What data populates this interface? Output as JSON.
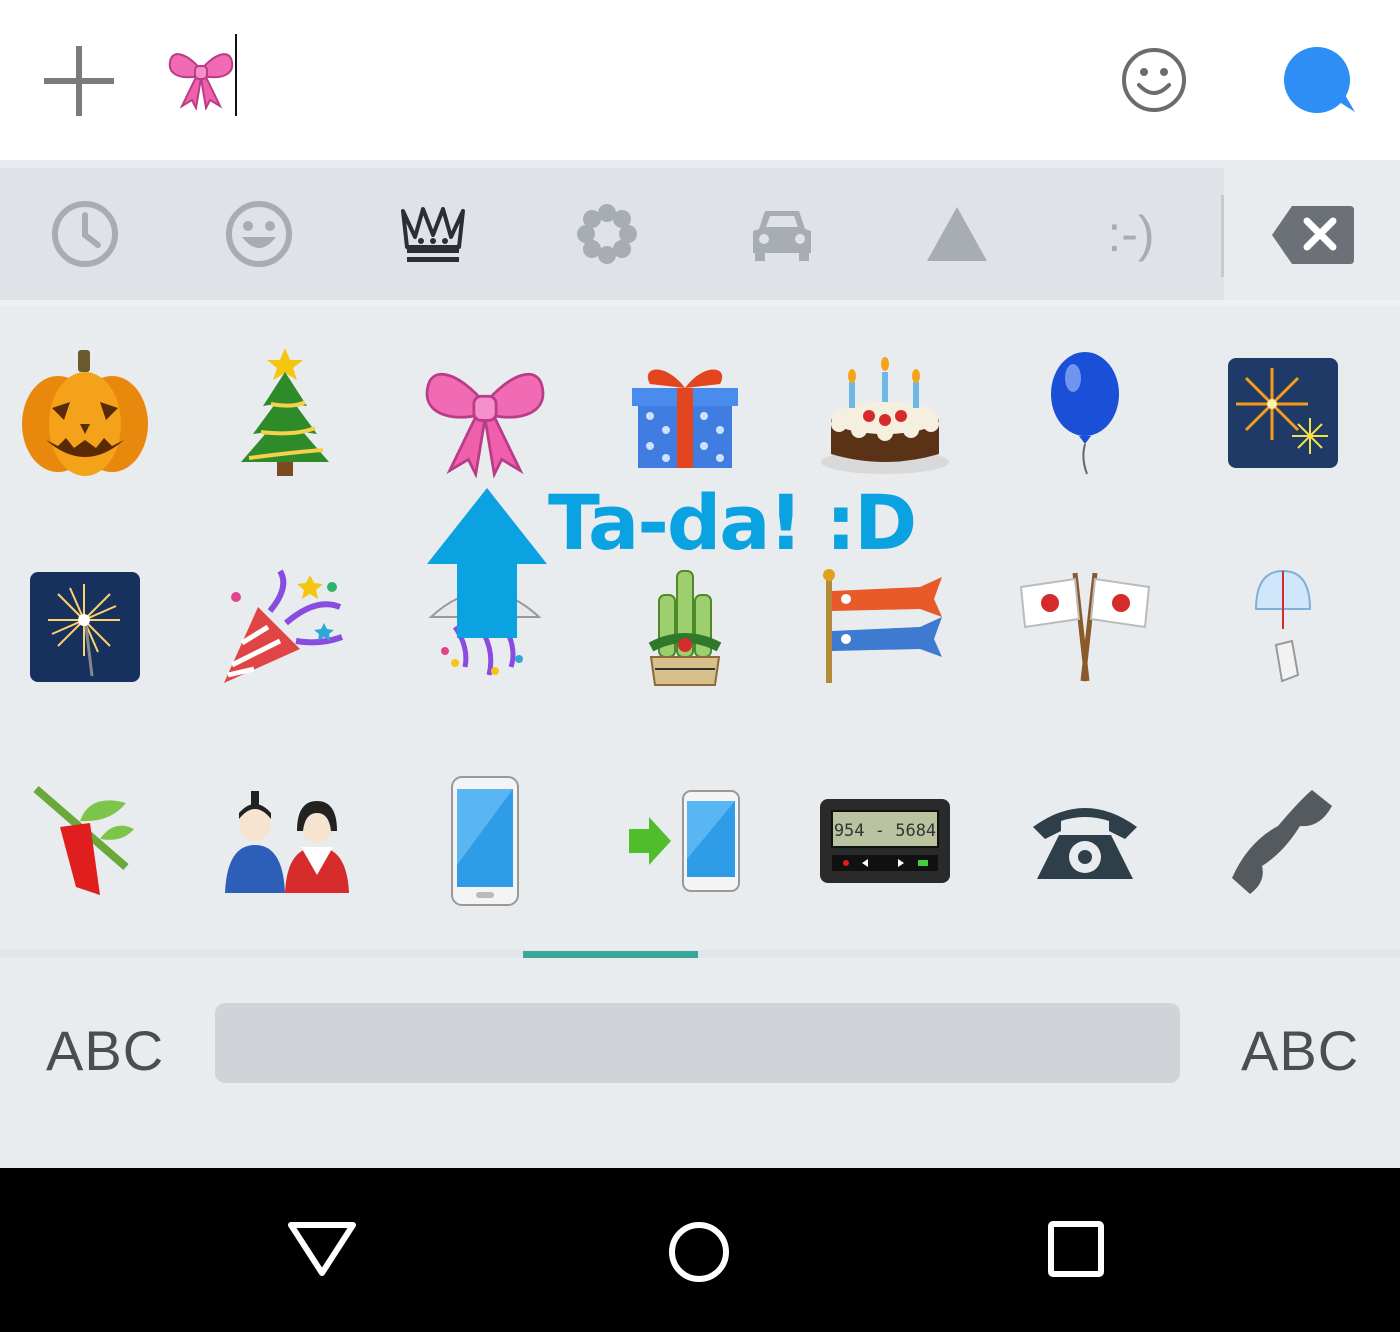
{
  "compose": {
    "add_icon": "plus-icon",
    "input_content": "ribbon-emoji",
    "emoji_button_icon": "smiley-icon",
    "send_button_icon": "chat-bubble-icon",
    "send_color": "#2d8ef5"
  },
  "categories": {
    "items": [
      {
        "name": "recent",
        "icon": "clock-icon"
      },
      {
        "name": "people",
        "icon": "smiley-face-icon"
      },
      {
        "name": "objects",
        "icon": "crown-icon",
        "selected": true
      },
      {
        "name": "nature",
        "icon": "flower-icon"
      },
      {
        "name": "places",
        "icon": "car-icon"
      },
      {
        "name": "symbols",
        "icon": "triangle-icon"
      },
      {
        "name": "emoticons",
        "label": ":-)"
      }
    ],
    "backspace_icon": "backspace-icon"
  },
  "emoji_grid": {
    "rows": [
      [
        "jack-o-lantern",
        "christmas-tree",
        "ribbon",
        "wrapped-gift",
        "birthday-cake",
        "balloon",
        "fireworks"
      ],
      [
        "sparkler",
        "party-popper",
        "confetti-ball",
        "pine-decoration",
        "carp-streamer",
        "crossed-flags",
        "wind-chime"
      ],
      [
        "tanabata-tree",
        "japanese-dolls",
        "mobile-phone",
        "mobile-phone-arrow",
        "pager",
        "telephone",
        "telephone-receiver"
      ]
    ],
    "pager_display": "954 - 5684"
  },
  "page_indicator": {
    "color": "#3aa79a"
  },
  "bottom_bar": {
    "left_label": "ABC",
    "right_label": "ABC"
  },
  "annotation": {
    "text": "Ta-da! :D",
    "color": "#0aa2e0"
  },
  "navigation": {
    "back_icon": "back-triangle-icon",
    "home_icon": "home-circle-icon",
    "recents_icon": "recents-square-icon"
  }
}
